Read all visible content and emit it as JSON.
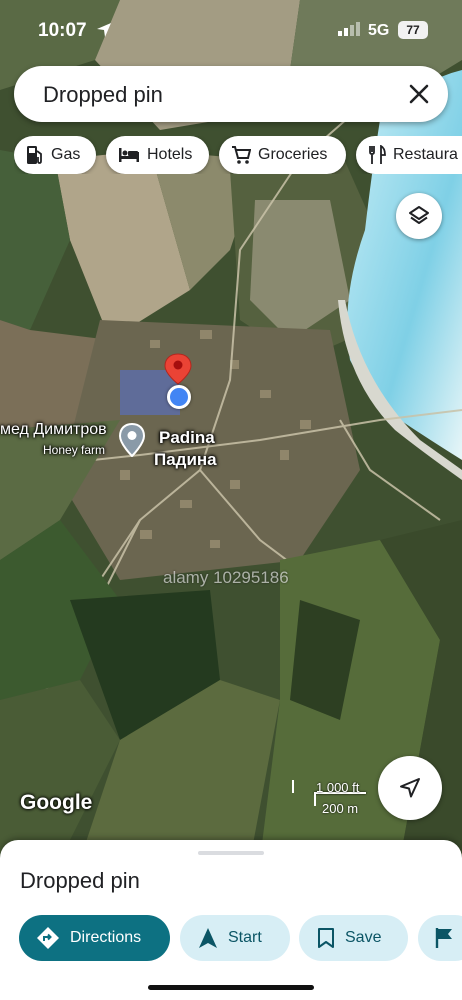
{
  "status_bar": {
    "time": "10:07",
    "network": "5G",
    "battery": "77"
  },
  "search": {
    "query": "Dropped pin"
  },
  "chips": [
    {
      "label": "Gas",
      "icon": "gas-station-icon"
    },
    {
      "label": "Hotels",
      "icon": "bed-icon"
    },
    {
      "label": "Groceries",
      "icon": "cart-icon"
    },
    {
      "label": "Restaura",
      "icon": "cutlery-icon"
    }
  ],
  "map": {
    "poi_name": "мед Димитров",
    "poi_subtitle": "Honey farm",
    "town_latin": "Padina",
    "town_cyrillic": "Падина",
    "watermark": "alamy 10295186",
    "logo": "Google",
    "scale_ft": "1 000 ft",
    "scale_m": "200 m",
    "colors": {
      "pin_red": "#ea4335",
      "my_location_blue": "#4285f4"
    }
  },
  "sheet": {
    "title": "Dropped pin",
    "actions": [
      {
        "label": "Directions",
        "icon": "directions-icon"
      },
      {
        "label": "Start",
        "icon": "navigation-arrow-icon"
      },
      {
        "label": "Save",
        "icon": "bookmark-icon"
      },
      {
        "label": "",
        "icon": "flag-icon"
      }
    ],
    "accent": "#0d7182"
  }
}
